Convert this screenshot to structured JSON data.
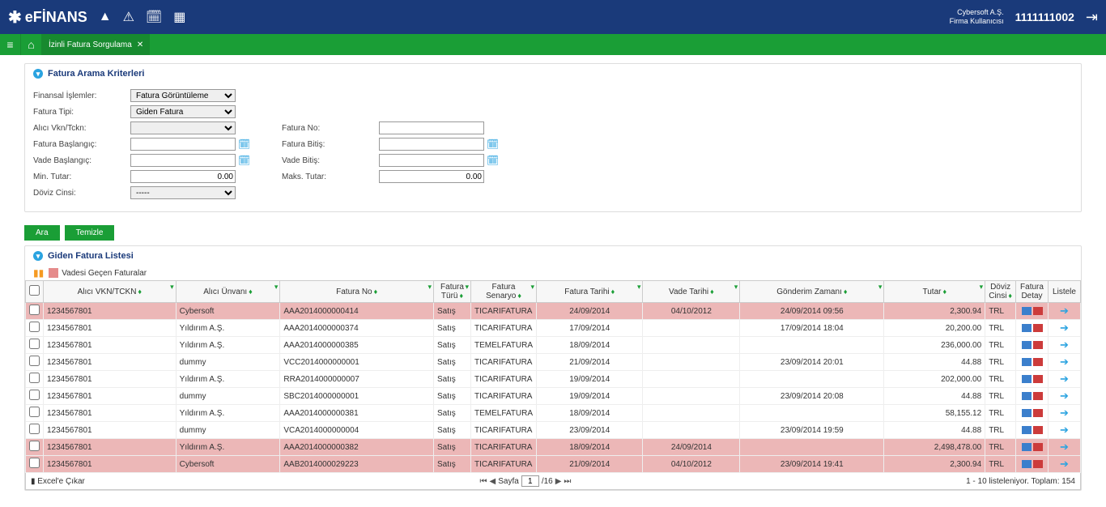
{
  "header": {
    "brand": "eFİNANS",
    "company": "Cybersoft A.Ş.",
    "role": "Firma Kullanıcısı",
    "userid": "1111111002"
  },
  "tab": {
    "title": "İzinli Fatura Sorgulama"
  },
  "search": {
    "title": "Fatura Arama Kriterleri",
    "labels": {
      "fin_ops": "Finansal İşlemler:",
      "fatura_tipi": "Fatura Tipi:",
      "alici_vkn": "Alıcı Vkn/Tckn:",
      "fatura_bas": "Fatura Başlangıç:",
      "vade_bas": "Vade Başlangıç:",
      "min_tutar": "Min. Tutar:",
      "doviz": "Döviz Cinsi:",
      "fatura_no": "Fatura No:",
      "fatura_bitis": "Fatura Bitiş:",
      "vade_bitis": "Vade Bitiş:",
      "maks_tutar": "Maks. Tutar:"
    },
    "values": {
      "fin_ops": "Fatura Görüntüleme",
      "fatura_tipi": "Giden Fatura",
      "doviz": "-----",
      "min_tutar": "0.00",
      "maks_tutar": "0.00"
    }
  },
  "buttons": {
    "search": "Ara",
    "clear": "Temizle"
  },
  "list": {
    "title": "Giden Fatura Listesi",
    "legend": "Vadesi Geçen Faturalar",
    "columns": {
      "vkn": "Alıcı VKN/TCKN",
      "unvan": "Alıcı Ünvanı",
      "fno": "Fatura No",
      "tur": "Fatura Türü",
      "senaryo": "Fatura Senaryo",
      "ftarih": "Fatura Tarihi",
      "vtarih": "Vade Tarihi",
      "gonderim": "Gönderim Zamanı",
      "tutar": "Tutar",
      "doviz": "Döviz Cinsi",
      "detay": "Fatura Detay",
      "listele": "Listele"
    },
    "rows": [
      {
        "overdue": true,
        "vkn": "1234567801",
        "unvan": "Cybersoft",
        "fno": "AAA2014000000414",
        "tur": "Satış",
        "senaryo": "TICARIFATURA",
        "ftarih": "24/09/2014",
        "vtarih": "04/10/2012",
        "gonderim": "24/09/2014 09:56",
        "tutar": "2,300.94",
        "doviz": "TRL"
      },
      {
        "overdue": false,
        "vkn": "1234567801",
        "unvan": "Yıldırım A.Ş.",
        "fno": "AAA2014000000374",
        "tur": "Satış",
        "senaryo": "TICARIFATURA",
        "ftarih": "17/09/2014",
        "vtarih": "",
        "gonderim": "17/09/2014 18:04",
        "tutar": "20,200.00",
        "doviz": "TRL"
      },
      {
        "overdue": false,
        "vkn": "1234567801",
        "unvan": "Yıldırım A.Ş.",
        "fno": "AAA2014000000385",
        "tur": "Satış",
        "senaryo": "TEMELFATURA",
        "ftarih": "18/09/2014",
        "vtarih": "",
        "gonderim": "",
        "tutar": "236,000.00",
        "doviz": "TRL"
      },
      {
        "overdue": false,
        "vkn": "1234567801",
        "unvan": "dummy",
        "fno": "VCC2014000000001",
        "tur": "Satış",
        "senaryo": "TICARIFATURA",
        "ftarih": "21/09/2014",
        "vtarih": "",
        "gonderim": "23/09/2014 20:01",
        "tutar": "44.88",
        "doviz": "TRL"
      },
      {
        "overdue": false,
        "vkn": "1234567801",
        "unvan": "Yıldırım A.Ş.",
        "fno": "RRA2014000000007",
        "tur": "Satış",
        "senaryo": "TICARIFATURA",
        "ftarih": "19/09/2014",
        "vtarih": "",
        "gonderim": "",
        "tutar": "202,000.00",
        "doviz": "TRL"
      },
      {
        "overdue": false,
        "vkn": "1234567801",
        "unvan": "dummy",
        "fno": "SBC2014000000001",
        "tur": "Satış",
        "senaryo": "TICARIFATURA",
        "ftarih": "19/09/2014",
        "vtarih": "",
        "gonderim": "23/09/2014 20:08",
        "tutar": "44.88",
        "doviz": "TRL"
      },
      {
        "overdue": false,
        "vkn": "1234567801",
        "unvan": "Yıldırım A.Ş.",
        "fno": "AAA2014000000381",
        "tur": "Satış",
        "senaryo": "TEMELFATURA",
        "ftarih": "18/09/2014",
        "vtarih": "",
        "gonderim": "",
        "tutar": "58,155.12",
        "doviz": "TRL"
      },
      {
        "overdue": false,
        "vkn": "1234567801",
        "unvan": "dummy",
        "fno": "VCA2014000000004",
        "tur": "Satış",
        "senaryo": "TICARIFATURA",
        "ftarih": "23/09/2014",
        "vtarih": "",
        "gonderim": "23/09/2014 19:59",
        "tutar": "44.88",
        "doviz": "TRL"
      },
      {
        "overdue": true,
        "vkn": "1234567801",
        "unvan": "Yıldırım A.Ş.",
        "fno": "AAA2014000000382",
        "tur": "Satış",
        "senaryo": "TICARIFATURA",
        "ftarih": "18/09/2014",
        "vtarih": "24/09/2014",
        "gonderim": "",
        "tutar": "2,498,478.00",
        "doviz": "TRL"
      },
      {
        "overdue": true,
        "vkn": "1234567801",
        "unvan": "Cybersoft",
        "fno": "AAB2014000029223",
        "tur": "Satış",
        "senaryo": "TICARIFATURA",
        "ftarih": "21/09/2014",
        "vtarih": "04/10/2012",
        "gonderim": "23/09/2014 19:41",
        "tutar": "2,300.94",
        "doviz": "TRL"
      }
    ]
  },
  "footer": {
    "export": "Excel'e Çıkar",
    "page_label": "Sayfa",
    "page": "1",
    "total_pages": "/16",
    "summary": "1 - 10 listeleniyor. Toplam: 154"
  }
}
